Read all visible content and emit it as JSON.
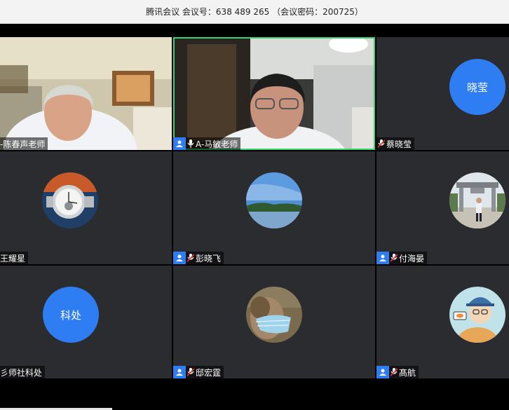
{
  "window": {
    "title": "腾讯会议 会议号：638 489 265 （会议密码：200725）"
  },
  "participants": [
    {
      "name": "-陈春声老师",
      "type": "video",
      "scene": "office"
    },
    {
      "name": "A-马敏老师",
      "type": "video",
      "scene": "study",
      "active": true,
      "mic": "on",
      "host_badge": true
    },
    {
      "name": "蔡晓莹",
      "type": "avatar-text",
      "avatar_text": "晓莹",
      "mic": "muted"
    },
    {
      "name": "王耀星",
      "type": "avatar-image",
      "image": "watch-icon"
    },
    {
      "name": "彭晓飞",
      "type": "avatar-image",
      "image": "lake-landscape-icon",
      "mic": "muted",
      "host_badge": true
    },
    {
      "name": "付海晏",
      "type": "avatar-image",
      "image": "gate-person-icon",
      "mic": "muted",
      "host_badge": true
    },
    {
      "name": "彡师社科处",
      "type": "avatar-text",
      "avatar_text": "科处"
    },
    {
      "name": "邸宏霆",
      "type": "avatar-image",
      "image": "masked-person-icon",
      "mic": "muted",
      "host_badge": true
    },
    {
      "name": "髙航",
      "type": "avatar-image",
      "image": "cartoon-person-icon",
      "mic": "muted",
      "host_badge": true
    }
  ],
  "colors": {
    "avatar_blue": "#2f7df3",
    "active_border": "#3bd16f",
    "tile_bg": "#2b2c2f"
  }
}
